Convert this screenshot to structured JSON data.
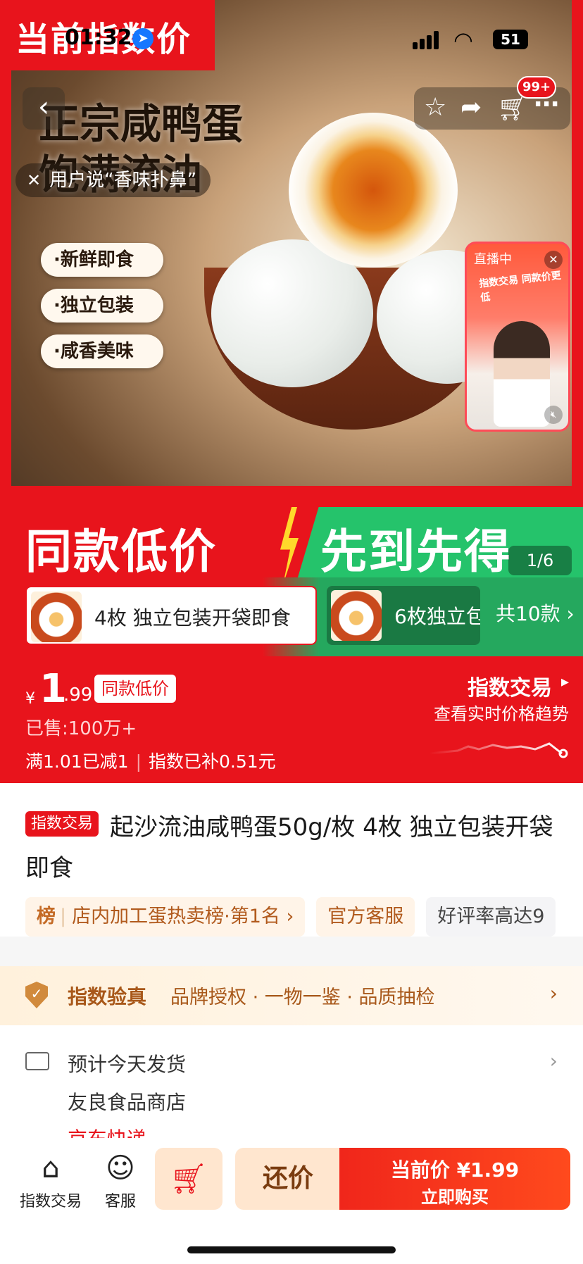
{
  "status_bar": {
    "time": "01:32",
    "battery": "51"
  },
  "hero": {
    "corner_banner": "当前指数价",
    "headline_line1": "正宗咸鸭蛋",
    "headline_line2": "饱满流油",
    "features": [
      "·新鲜即食",
      "·独立包装",
      "·咸香美味"
    ],
    "strip_left": "同款低价",
    "strip_right": "先到先得",
    "image_counter": "1/6"
  },
  "nav": {
    "cart_badge": "99+"
  },
  "review_chip": {
    "text": "用户说“香味扑鼻”"
  },
  "live": {
    "tag": "直播中",
    "slogan": "指数交易 同款价更低"
  },
  "variants": {
    "items": [
      {
        "label": "4枚 独立包装开袋即食"
      },
      {
        "label": "6枚独立包"
      }
    ],
    "more": "共10款 ›"
  },
  "price": {
    "currency": "¥",
    "integer": "1",
    "decimal": ".99",
    "badge": "同款低价",
    "sold": "已售:100万+",
    "promo1": "满1.01已减1",
    "promo2": "指数已补0.51元",
    "index_title": "指数交易",
    "index_sub": "查看实时价格趋势"
  },
  "product": {
    "tag": "指数交易",
    "title": "起沙流油咸鸭蛋50g/枚 4枚 独立包装开袋即食",
    "chips": {
      "rank_label": "榜",
      "rank_text": "店内加工蛋热卖榜·第1名 ›",
      "service": "官方客服",
      "rating": "好评率高达9"
    }
  },
  "verify": {
    "title": "指数验真",
    "items": "品牌授权 · 一物一鉴 · 品质抽检"
  },
  "shipping": {
    "line1": "预计今天发货",
    "line2": "友良食品商店",
    "line3": "京东快递"
  },
  "bottom_bar": {
    "index_trade": "指数交易",
    "service": "客服",
    "bargain": "还价",
    "buy_line1": "当前价 ¥1.99",
    "buy_line2": "立即购买"
  },
  "colors": {
    "brand_red": "#e8141c",
    "green": "#25c36b",
    "accent_orange": "#a8581a"
  }
}
